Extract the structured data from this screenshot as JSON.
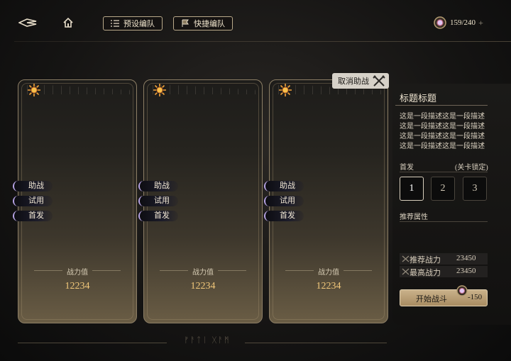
{
  "top": {
    "preset_label": "预设编队",
    "quick_label": "快捷编队",
    "stamina": "159/240",
    "plus": "+"
  },
  "cancel_assist": "取消助战",
  "cards": [
    {
      "tags": [
        "助战",
        "试用",
        "首发"
      ],
      "power_label": "战力值",
      "power_value": "12234"
    },
    {
      "tags": [
        "助战",
        "试用",
        "首发"
      ],
      "power_label": "战力值",
      "power_value": "12234"
    },
    {
      "tags": [
        "助战",
        "试用",
        "首发"
      ],
      "power_label": "战力值",
      "power_value": "12234"
    }
  ],
  "panel": {
    "title": "标题标题",
    "description": "这是一段描述这是一段描述这是一段描述这是一段描述这是一段描述这是一段描述这是一段描述这是一段描述这是一段",
    "starter_label": "首发",
    "stage_lock": "(关卡锁定)",
    "slots": [
      "1",
      "2",
      "3"
    ],
    "recommend_attr": "推荐属性",
    "rec_power_label": "推荐战力",
    "rec_power_value": "23450",
    "max_power_label": "最高战力",
    "max_power_value": "23450",
    "start_label": "开始战斗",
    "cost": "-150"
  },
  "bottom_glyphs": "ᚠᚨᛏᛁ ᚷᚨᛗ"
}
